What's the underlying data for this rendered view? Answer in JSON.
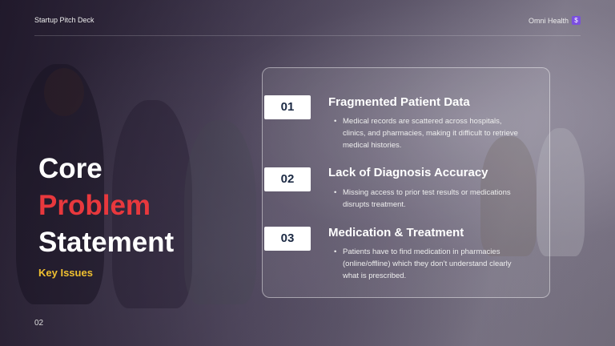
{
  "header": {
    "deck_label": "Startup Pitch Deck",
    "brand_name": "Omni Health",
    "brand_icon": "dollar-sign-icon"
  },
  "title": {
    "line1": "Core",
    "line2": "Problem",
    "line3": "Statement",
    "accent_color": "#e8383d"
  },
  "subtitle": "Key Issues",
  "subtitle_color": "#f0c030",
  "page_number": "02",
  "items": [
    {
      "number": "01",
      "title": "Fragmented Patient Data",
      "description": "Medical records are scattered across hospitals, clinics, and pharmacies, making it difficult to retrieve medical histories."
    },
    {
      "number": "02",
      "title": "Lack of Diagnosis Accuracy",
      "description": "Missing access to prior test results or medications disrupts treatment."
    },
    {
      "number": "03",
      "title": "Medication & Treatment",
      "description": "Patients have to find medication in pharmacies (online/offline) which they don’t understand clearly what is prescribed."
    }
  ]
}
